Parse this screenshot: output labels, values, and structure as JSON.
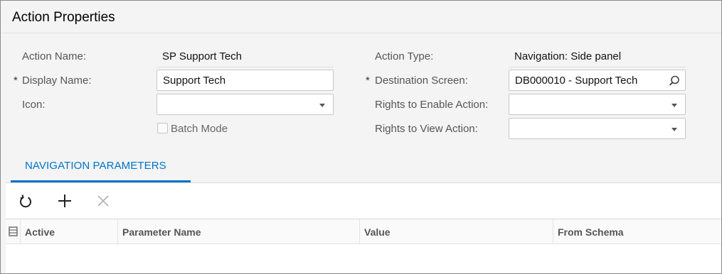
{
  "dialog": {
    "title": "Action Properties"
  },
  "form": {
    "action_name": {
      "label": "Action Name:",
      "value": "SP Support Tech"
    },
    "display_name": {
      "required": "*",
      "label": "Display Name:",
      "value": "Support Tech"
    },
    "icon": {
      "label": "Icon:",
      "value": ""
    },
    "batch_mode": {
      "label": "Batch Mode",
      "checked": false
    },
    "action_type": {
      "label": "Action Type:",
      "value": "Navigation: Side panel"
    },
    "destination_screen": {
      "required": "*",
      "label": "Destination Screen:",
      "value": "DB000010 - Support Tech"
    },
    "rights_enable": {
      "label": "Rights to Enable Action:",
      "value": ""
    },
    "rights_view": {
      "label": "Rights to View Action:",
      "value": ""
    }
  },
  "tabs": [
    {
      "label": "NAVIGATION PARAMETERS",
      "active": true
    }
  ],
  "toolbar": {
    "icons": [
      "refresh-icon",
      "add-icon",
      "delete-icon"
    ]
  },
  "grid": {
    "columns": [
      "Active",
      "Parameter Name",
      "Value",
      "From Schema"
    ],
    "rows": []
  },
  "colors": {
    "accent": "#0073c8",
    "background": "#f4f4f4"
  }
}
